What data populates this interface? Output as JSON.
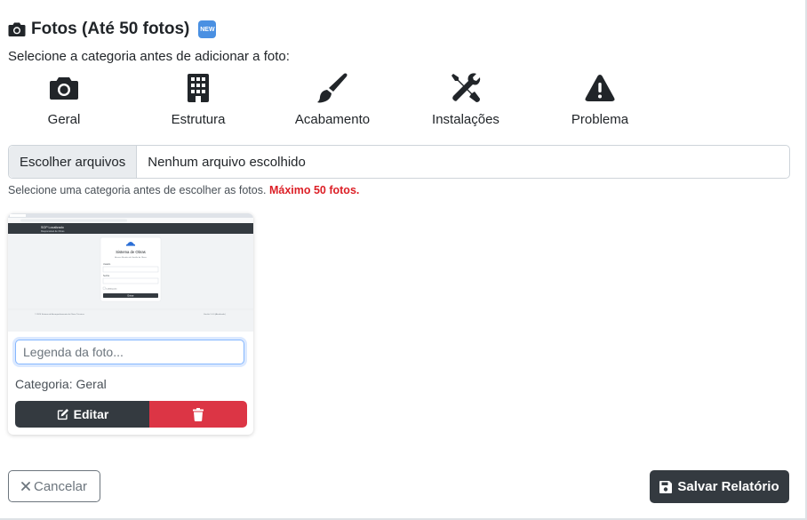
{
  "section": {
    "title": "Fotos (Até 50 fotos)",
    "new_badge": "NEW",
    "instruction": "Selecione a categoria antes de adicionar a foto:"
  },
  "categories": [
    {
      "label": "Geral",
      "icon": "camera-icon"
    },
    {
      "label": "Estrutura",
      "icon": "building-icon"
    },
    {
      "label": "Acabamento",
      "icon": "paint-brush-icon"
    },
    {
      "label": "Instalações",
      "icon": "tools-icon"
    },
    {
      "label": "Problema",
      "icon": "warning-icon"
    }
  ],
  "file_input": {
    "button_label": "Escolher arquivos",
    "status": "Nenhum arquivo escolhido"
  },
  "hint": {
    "text": "Selecione uma categoria antes de escolher as fotos.",
    "max_text": "Máximo 50 fotos."
  },
  "photo_card": {
    "thumbnail": {
      "header_title": "SGP Localizado",
      "header_subtitle": "Responsável de Obras",
      "login_title": "Sistema de Obras",
      "login_subtitle": "Acesso Restrito de Gestão de Obras",
      "field1": "Usuário",
      "field2": "Senha",
      "remember": "Lembrar-me",
      "button": "Entrar",
      "footer_left": "© 2024 Sistema de Acompanhamento de Obras Técnicas",
      "footer_right": "Versão 1.0.0 (Atualizado)"
    },
    "caption_placeholder": "Legenda da foto...",
    "caption_value": "",
    "category_text": "Categoria: Geral",
    "edit_label": "Editar"
  },
  "footer": {
    "cancel_label": "Cancelar",
    "save_label": "Salvar Relatório"
  },
  "colors": {
    "dark": "#343a40",
    "danger": "#dc3545",
    "hint_red": "#dc1f26",
    "focus_border": "#86b7fe",
    "badge_blue": "#4a90e2"
  }
}
